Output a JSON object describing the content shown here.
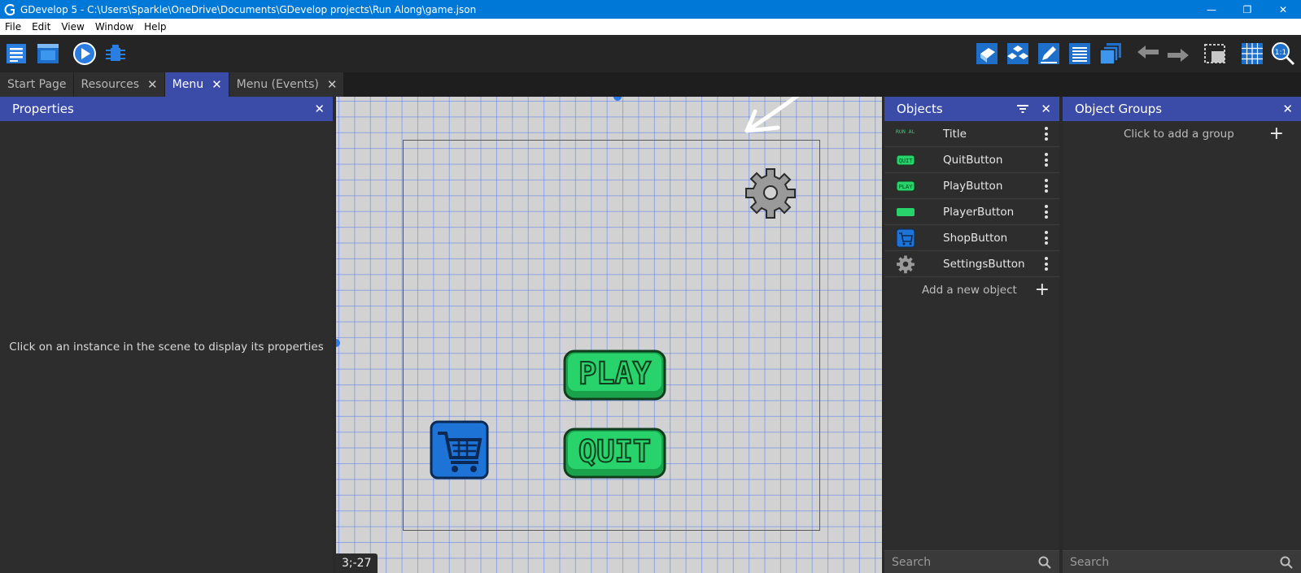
{
  "window": {
    "title": "GDevelop 5 - C:\\Users\\Sparkle\\OneDrive\\Documents\\GDevelop projects\\Run Along\\game.json",
    "minimize": "—",
    "restore": "❐",
    "close": "✕"
  },
  "menu": [
    "File",
    "Edit",
    "View",
    "Window",
    "Help"
  ],
  "tabs": [
    {
      "label": "Start Page",
      "closable": false,
      "active": false
    },
    {
      "label": "Resources",
      "closable": true,
      "active": false
    },
    {
      "label": "Menu",
      "closable": true,
      "active": true
    },
    {
      "label": "Menu (Events)",
      "closable": true,
      "active": false
    }
  ],
  "properties": {
    "title": "Properties",
    "empty_message": "Click on an instance in the scene to display its properties"
  },
  "scene": {
    "coords": "3;-27",
    "play_label": "PLAY",
    "quit_label": "QUIT"
  },
  "objects": {
    "title": "Objects",
    "items": [
      {
        "name": "Title",
        "thumb": "title-thumb-icon",
        "thumb_text": "RUN ALONG"
      },
      {
        "name": "QuitButton",
        "thumb": "quit-thumb-icon",
        "thumb_text": "QUIT"
      },
      {
        "name": "PlayButton",
        "thumb": "play-thumb-icon",
        "thumb_text": "PLAY"
      },
      {
        "name": "PlayerButton",
        "thumb": "player-thumb-icon",
        "thumb_text": ""
      },
      {
        "name": "ShopButton",
        "thumb": "cart-icon",
        "thumb_text": ""
      },
      {
        "name": "SettingsButton",
        "thumb": "gear-icon",
        "thumb_text": ""
      }
    ],
    "add_label": "Add a new object",
    "search_placeholder": "Search"
  },
  "groups": {
    "title": "Object Groups",
    "add_label": "Click to add a group",
    "search_placeholder": "Search"
  },
  "colors": {
    "accent": "#3b4ba8",
    "titlebar": "#0078d7",
    "button_green": "#22c55e"
  }
}
